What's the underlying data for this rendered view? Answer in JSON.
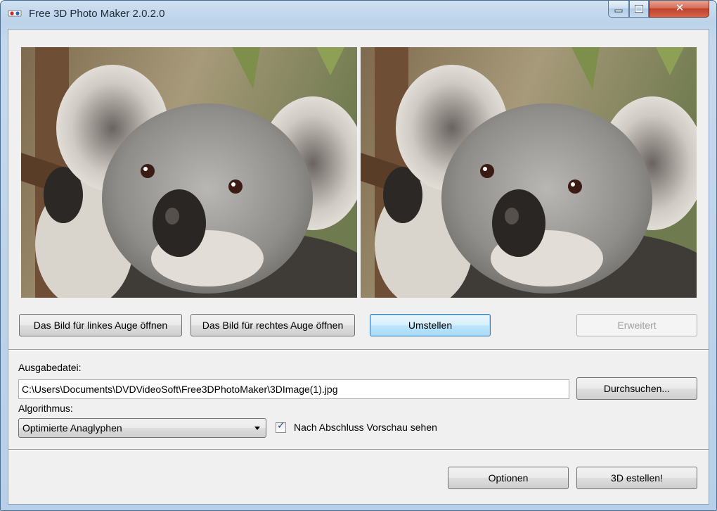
{
  "window": {
    "title": "Free 3D Photo Maker 2.0.2.0",
    "close_glyph": "✕",
    "accent_colors": {
      "titlebar": "#bcd3ea",
      "close_button": "#c1432b",
      "default_button": "#3c7fb1"
    }
  },
  "images": {
    "left_eye": "koala photo (left eye)",
    "right_eye": "koala photo (right eye)"
  },
  "buttons": {
    "open_left": "Das Bild für linkes Auge öffnen",
    "open_right": "Das Bild für rechtes Auge öffnen",
    "swap": "Umstellen",
    "advanced": "Erweitert",
    "browse": "Durchsuchen...",
    "options": "Optionen",
    "create": "3D estellen!"
  },
  "output": {
    "label": "Ausgabedatei:",
    "path": "C:\\Users\\Documents\\DVDVideoSoft\\Free3DPhotoMaker\\3DImage(1).jpg"
  },
  "algorithm": {
    "label": "Algorithmus:",
    "selected": "Optimierte Anaglyphen"
  },
  "preview": {
    "label": "Nach Abschluss Vorschau sehen",
    "checked": true,
    "check_glyph": "✓"
  }
}
